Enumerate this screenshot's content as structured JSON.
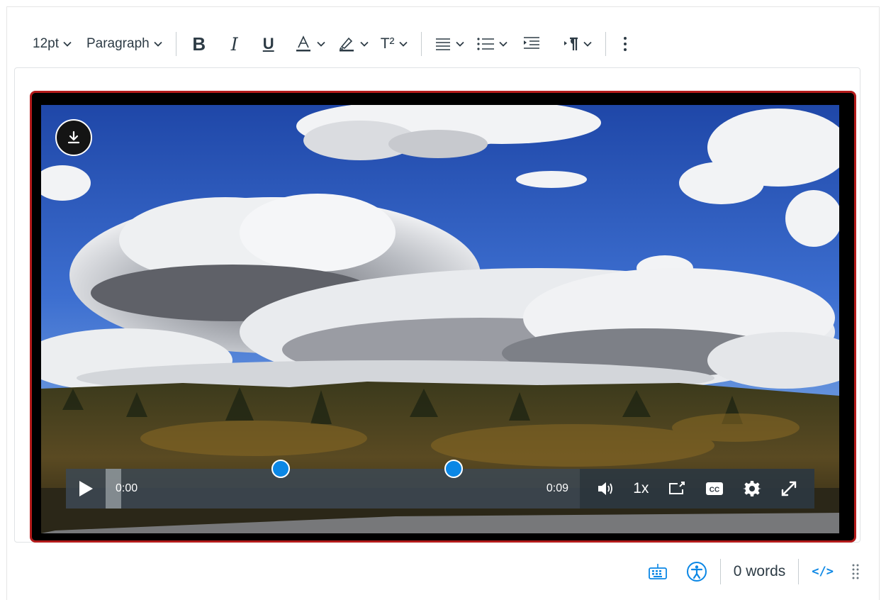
{
  "toolbar": {
    "font_size": "12pt",
    "block_format": "Paragraph",
    "bold_label": "B",
    "italic_label": "I",
    "underline_label": "U",
    "superscript_label": "T²",
    "icons": [
      "bold-icon",
      "italic-icon",
      "underline-icon",
      "text-color-icon",
      "highlight-color-icon",
      "superscript-icon",
      "align-icon",
      "list-icon",
      "indent-icon",
      "text-direction-icon",
      "more-icon"
    ]
  },
  "video": {
    "current_time": "0:00",
    "duration": "0:09",
    "playback_rate": "1x",
    "cc_label": "CC",
    "icons": [
      "download-icon",
      "play-icon",
      "volume-icon",
      "picture-in-picture-icon",
      "captions-icon",
      "settings-icon",
      "fullscreen-icon"
    ],
    "accent_color": "#0b87e5",
    "selection_border_color": "#b31b1b"
  },
  "statusbar": {
    "word_count": "0 words",
    "html_toggle": "</>",
    "icons": [
      "keyboard-icon",
      "accessibility-icon",
      "resize-handle-icon"
    ]
  }
}
